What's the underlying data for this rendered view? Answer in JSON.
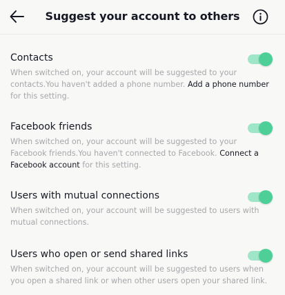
{
  "header": {
    "title": "Suggest your account to others",
    "back_icon": "arrow-left-icon",
    "info_icon": "info-circle-icon"
  },
  "colors": {
    "toggle_on": "#4ecf97",
    "toggle_track": "#9ee6c7",
    "secondary_text": "#a7a7ab",
    "primary_text": "#161823"
  },
  "settings": [
    {
      "label": "Contacts",
      "enabled": true,
      "desc_text": "When switched on, your account will be suggested to your contacts.You haven't added a phone number. ",
      "link": "Add a phone number",
      "desc_after": " for this setting."
    },
    {
      "label": "Facebook friends",
      "enabled": true,
      "desc_text": "When switched on, your account will be suggested to your Facebook friends.You haven't connected to Facebook. ",
      "link": "Connect a Facebook account",
      "desc_after": " for this setting."
    },
    {
      "label": "Users with mutual connections",
      "enabled": true,
      "desc_text": "When switched on, your account will be suggested to users with mutual connections."
    },
    {
      "label": "Users who open or send shared links",
      "enabled": true,
      "desc_text": "When switched on, your account will be suggested to users when you open a shared link or when other users open your shared link."
    }
  ]
}
